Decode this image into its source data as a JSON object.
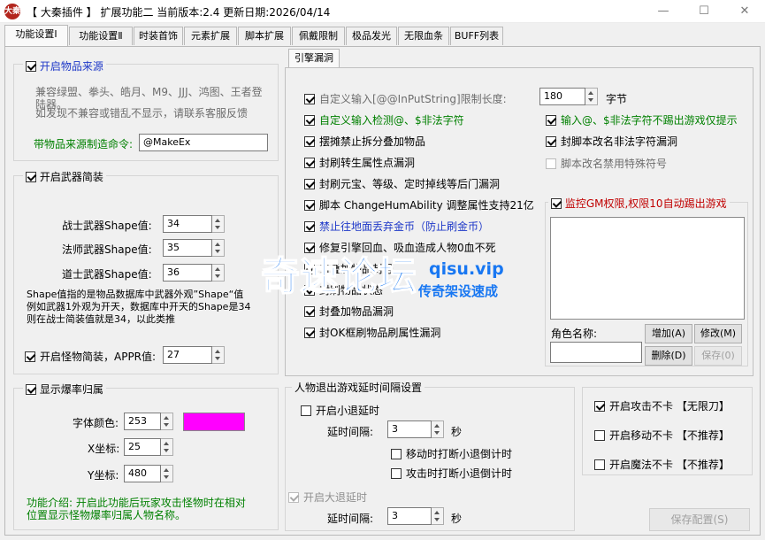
{
  "window": {
    "title": "【 大秦插件 】 扩展功能二 当前版本:2.4 更新日期:2026/04/14",
    "app_icon": "大秦",
    "minimize": "—",
    "maximize": "☐",
    "close": "✕"
  },
  "tabs": [
    {
      "label": "功能设置Ⅰ"
    },
    {
      "label": "功能设置Ⅱ"
    },
    {
      "label": "时装首饰"
    },
    {
      "label": "元素扩展"
    },
    {
      "label": "脚本扩展"
    },
    {
      "label": "佩戴限制"
    },
    {
      "label": "极品发光"
    },
    {
      "label": "无限血条"
    },
    {
      "label": "BUFF列表"
    }
  ],
  "item_source": {
    "title": "开启物品来源",
    "compat_text": "兼容绿盟、拳头、皓月、M9、JJJ、鸿图、王者登陆器。",
    "compat_text2": "如发现不兼容或错乱不显示，请联系客服反馈",
    "command_label": "带物品来源制造命令:",
    "command_value": "@MakeEx"
  },
  "weapon_skin": {
    "title": "开启武器简装",
    "warrior_label": "战士武器Shape值:",
    "warrior_value": "34",
    "mage_label": "法师武器Shape值:",
    "mage_value": "35",
    "taoist_label": "道士武器Shape值:",
    "taoist_value": "36",
    "desc1": "Shape值指的是物品数据库中武器外观”Shape“值",
    "desc2": "例如武器1外观为开天，数据库中开天的Shape是34",
    "desc3": "则在战士简装值就是34，以此类推",
    "monster_label": "开启怪物简装，APPR值:",
    "monster_value": "27"
  },
  "drop_owner": {
    "title": "显示爆率归属",
    "font_color_label": "字体颜色:",
    "font_color_value": "253",
    "swatch_color": "#ff00ff",
    "x_label": "X坐标:",
    "x_value": "25",
    "y_label": "Y坐标:",
    "y_value": "480",
    "intro": "功能介绍: 开启此功能后玩家攻击怪物时在相对",
    "intro2": "位置显示怪物爆率归属人物名称。"
  },
  "engine_tab": {
    "label": "引擎漏洞"
  },
  "engine": {
    "limit_len_label": "自定义输入[@@InPutString]限制长度:",
    "limit_len_value": "180",
    "limit_unit": "字节",
    "items": [
      {
        "label": "自定义输入检测@、$非法字符",
        "checked": true,
        "color": "green"
      },
      {
        "label": "摆摊禁止拆分叠加物品",
        "checked": true,
        "color": "black"
      },
      {
        "label": "封刷转生属性点漏洞",
        "checked": true,
        "color": "black"
      },
      {
        "label": "封刷元宝、等级、定时掉线等后门漏洞",
        "checked": true,
        "color": "black"
      },
      {
        "label": "脚本 ChangeHumAbility 调整属性支持21亿",
        "checked": true,
        "color": "black"
      },
      {
        "label": "禁止往地面丢弃金币（防止刷金币）",
        "checked": true,
        "color": "blue"
      },
      {
        "label": "修复引擎回血、吸血造成人物0血不死",
        "checked": true,
        "color": "black"
      },
      {
        "label": "封叠加物品封号",
        "checked": true,
        "color": "black"
      },
      {
        "label": "封刷物品状态",
        "checked": true,
        "color": "black"
      },
      {
        "label": "封叠加物品漏洞",
        "checked": true,
        "color": "black"
      },
      {
        "label": "封OK框刷物品刷属性漏洞",
        "checked": true,
        "color": "black"
      }
    ],
    "right_items": [
      {
        "label": "输入@、$非法字符不踢出游戏仅提示",
        "checked": true,
        "color": "green"
      },
      {
        "label": "封脚本改名非法字符漏洞",
        "checked": true,
        "color": "black"
      },
      {
        "label": "脚本改名禁用特殊符号",
        "checked": false,
        "color": "gray"
      }
    ],
    "gm": {
      "title": "监控GM权限,权限10自动踢出游戏",
      "name_label": "角色名称:",
      "name_value": "",
      "add": "增加(A)",
      "edit": "修改(M)",
      "delete": "删除(D)",
      "save": "保存(0)"
    }
  },
  "exit_delay": {
    "title": "人物退出游戏延时间隔设置",
    "small_label": "开启小退延时",
    "small_delay_label": "延时间隔:",
    "small_delay_value": "3",
    "sec": "秒",
    "opt1": "移动时打断小退倒计时",
    "opt2": "攻击时打断小退倒计时",
    "big_label": "开启大退延时",
    "big_delay_label": "延时间隔:",
    "big_delay_value": "3",
    "sec2": "秒"
  },
  "no_lag": {
    "attack": "开启攻击不卡 【无限刀】",
    "move": "开启移动不卡 【不推荐】",
    "magic": "开启魔法不卡 【不推荐】"
  },
  "save_config": "保存配置(S)",
  "watermark": {
    "main": "奇速论坛",
    "url": "qisu.vip",
    "slogan": "传奇架设速成"
  }
}
